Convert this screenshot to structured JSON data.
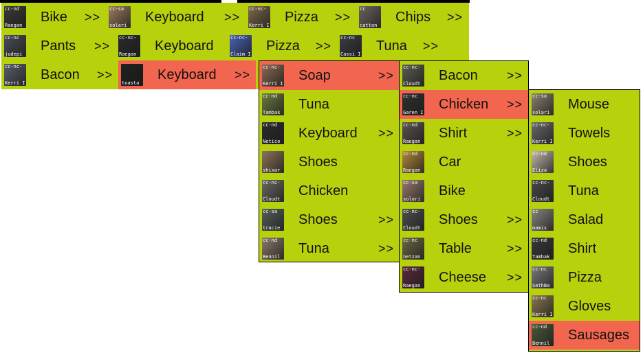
{
  "arrow_glyph": ">>",
  "colors": {
    "menu_bg": "#b7d20c",
    "selected_bg": "#f2664f",
    "border": "#000000"
  },
  "menubar": {
    "rows": [
      [
        {
          "label": "Bike",
          "arrow": true,
          "selected": false,
          "thumb": {
            "top": "cc-nd",
            "bottom": "Raegan",
            "color": "#3b3a35"
          }
        },
        {
          "label": "Keyboard",
          "arrow": true,
          "selected": false,
          "thumb": {
            "top": "cc-sa",
            "bottom": "solari",
            "color": "#9b7d5f"
          }
        },
        {
          "label": "Pizza",
          "arrow": true,
          "selected": false,
          "thumb": {
            "top": "cc-nc-",
            "bottom": "Kerri I",
            "color": "#7d6a4a"
          }
        },
        {
          "label": "Chips",
          "arrow": true,
          "selected": false,
          "thumb": {
            "top": "cc",
            "bottom": "cattan",
            "color": "#6c6560"
          }
        }
      ],
      [
        {
          "label": "Pants",
          "arrow": true,
          "selected": false,
          "thumb": {
            "top": "cc-nc",
            "bottom": "judepi",
            "color": "#4a4e58"
          }
        },
        {
          "label": "Keyboard",
          "arrow": false,
          "selected": false,
          "thumb": {
            "top": "cc-nc-",
            "bottom": "Raegan",
            "color": "#2a2a2a"
          }
        },
        {
          "label": "Pizza",
          "arrow": true,
          "selected": false,
          "thumb": {
            "top": "cc-nc-",
            "bottom": "Claim I",
            "color": "#4a62b8"
          }
        },
        {
          "label": "Tuna",
          "arrow": true,
          "selected": false,
          "thumb": {
            "top": "cc-nc",
            "bottom": "Cassi I",
            "color": "#3a3d44"
          }
        }
      ],
      [
        {
          "label": "Bacon",
          "arrow": true,
          "selected": false,
          "thumb": {
            "top": "cc-nc-",
            "bottom": "Kerri I",
            "color": "#5a6068"
          }
        },
        {
          "label": "Keyboard",
          "arrow": true,
          "selected": true,
          "thumb": {
            "top": "",
            "bottom": "toasta",
            "color": "#202020"
          }
        }
      ]
    ]
  },
  "submenus": [
    {
      "items": [
        {
          "label": "Soap",
          "arrow": true,
          "selected": true,
          "thumb": {
            "top": "cc-nc-",
            "bottom": "Kerri I",
            "color": "#8a6a55"
          }
        },
        {
          "label": "Tuna",
          "arrow": false,
          "selected": false,
          "thumb": {
            "top": "cc-nd",
            "bottom": "Tambak",
            "color": "#6f7a40"
          }
        },
        {
          "label": "Keyboard",
          "arrow": true,
          "selected": false,
          "thumb": {
            "top": "cc-nd",
            "bottom": "Netico",
            "color": "#2c2c2c"
          }
        },
        {
          "label": "Shoes",
          "arrow": false,
          "selected": false,
          "thumb": {
            "top": "",
            "bottom": "shixar",
            "color": "#8a7458"
          }
        },
        {
          "label": "Chicken",
          "arrow": false,
          "selected": false,
          "thumb": {
            "top": "cc-nc-",
            "bottom": "Cloudt",
            "color": "#6d6a60"
          }
        },
        {
          "label": "Shoes",
          "arrow": true,
          "selected": false,
          "thumb": {
            "top": "cc-sa",
            "bottom": "tracie",
            "color": "#55605a"
          }
        },
        {
          "label": "Tuna",
          "arrow": true,
          "selected": false,
          "thumb": {
            "top": "cc-nd",
            "bottom": "Bennil",
            "color": "#8c7a6a"
          }
        }
      ]
    },
    {
      "items": [
        {
          "label": "Bacon",
          "arrow": true,
          "selected": false,
          "thumb": {
            "top": "cc-nc-",
            "bottom": "Cloudt",
            "color": "#5a5f50"
          }
        },
        {
          "label": "Chicken",
          "arrow": true,
          "selected": true,
          "thumb": {
            "top": "cc-nc",
            "bottom": "Garen I",
            "color": "#303030"
          }
        },
        {
          "label": "Shirt",
          "arrow": true,
          "selected": false,
          "thumb": {
            "top": "cc-nd",
            "bottom": "Raegan",
            "color": "#5a5450"
          }
        },
        {
          "label": "Car",
          "arrow": false,
          "selected": false,
          "thumb": {
            "top": "cc-nd",
            "bottom": "Raegan",
            "color": "#b08a3a"
          }
        },
        {
          "label": "Bike",
          "arrow": false,
          "selected": false,
          "thumb": {
            "top": "cc-sa",
            "bottom": "solari",
            "color": "#9a7a70"
          }
        },
        {
          "label": "Shoes",
          "arrow": true,
          "selected": false,
          "thumb": {
            "top": "cc-nc-",
            "bottom": "Cloudt",
            "color": "#4d5050"
          }
        },
        {
          "label": "Table",
          "arrow": true,
          "selected": false,
          "thumb": {
            "top": "cc-nc",
            "bottom": "netzan",
            "color": "#6a6a45"
          }
        },
        {
          "label": "Cheese",
          "arrow": true,
          "selected": false,
          "thumb": {
            "top": "cc-nc-",
            "bottom": "Raegan",
            "color": "#5a2a3a"
          }
        }
      ]
    },
    {
      "items": [
        {
          "label": "Mouse",
          "arrow": false,
          "selected": false,
          "thumb": {
            "top": "cc-sa",
            "bottom": "solari",
            "color": "#8a8070"
          }
        },
        {
          "label": "Towels",
          "arrow": false,
          "selected": false,
          "thumb": {
            "top": "cc-nc-",
            "bottom": "Kerri I",
            "color": "#6a6a6a"
          }
        },
        {
          "label": "Shoes",
          "arrow": false,
          "selected": false,
          "thumb": {
            "top": "cc-nd",
            "bottom": "Eliza",
            "color": "#c4b8a8"
          }
        },
        {
          "label": "Tuna",
          "arrow": false,
          "selected": false,
          "thumb": {
            "top": "cc-nc-",
            "bottom": "Cloudt",
            "color": "#4a4a4a"
          }
        },
        {
          "label": "Salad",
          "arrow": false,
          "selected": false,
          "thumb": {
            "top": "cc",
            "bottom": "mamis",
            "color": "#8a8680"
          }
        },
        {
          "label": "Shirt",
          "arrow": false,
          "selected": false,
          "thumb": {
            "top": "cc-nd",
            "bottom": "Tambak",
            "color": "#3a3a3a"
          }
        },
        {
          "label": "Pizza",
          "arrow": false,
          "selected": false,
          "thumb": {
            "top": "cc-nc",
            "bottom": "SethBa",
            "color": "#7a7a7a"
          }
        },
        {
          "label": "Gloves",
          "arrow": false,
          "selected": false,
          "thumb": {
            "top": "cc-nc",
            "bottom": "Kerri I",
            "color": "#8a7a50"
          }
        },
        {
          "label": "Sausages",
          "arrow": false,
          "selected": true,
          "thumb": {
            "top": "cc-nd",
            "bottom": "Bennil",
            "color": "#4a5a3a"
          }
        }
      ]
    }
  ]
}
